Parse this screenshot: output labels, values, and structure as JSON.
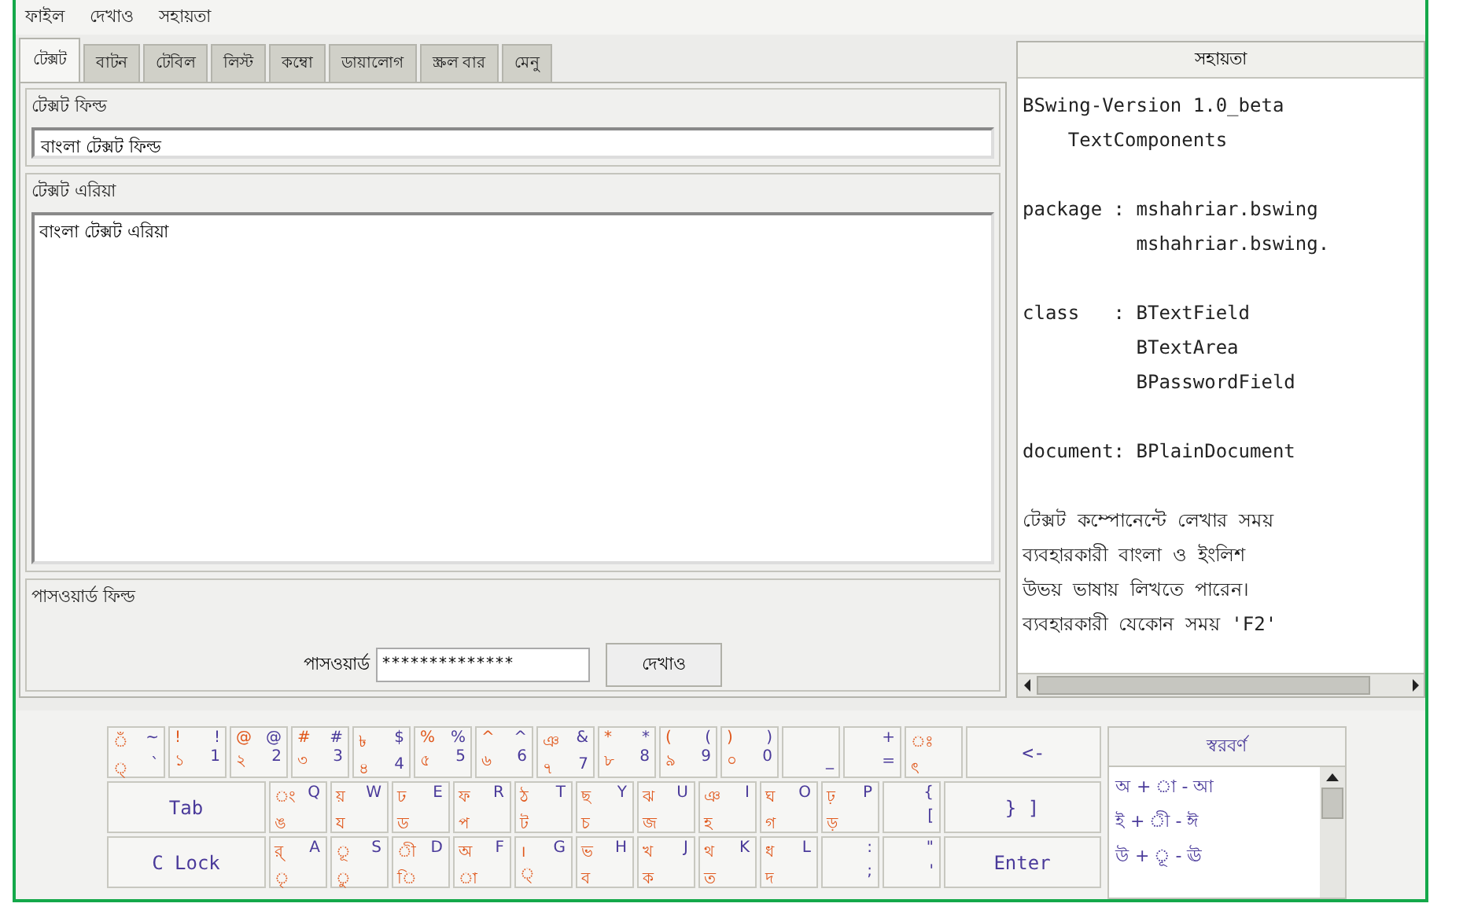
{
  "menu": [
    {
      "label": "ফাইল"
    },
    {
      "label": "দেখাও"
    },
    {
      "label": "সহায়তা"
    }
  ],
  "tabs": [
    {
      "label": "টেক্সট",
      "selected": true
    },
    {
      "label": "বাটন",
      "selected": false
    },
    {
      "label": "টেবিল",
      "selected": false
    },
    {
      "label": "লিস্ট",
      "selected": false
    },
    {
      "label": "কম্বো",
      "selected": false
    },
    {
      "label": "ডায়ালোগ",
      "selected": false
    },
    {
      "label": "স্ক্রল বার",
      "selected": false
    },
    {
      "label": "মেনু",
      "selected": false
    }
  ],
  "text_field_group": {
    "title": "টেক্সট ফিল্ড",
    "value": "বাংলা টেক্সট ফিল্ড"
  },
  "text_area_group": {
    "title": "টেক্সট এরিয়া",
    "value": "বাংলা টেক্সট এরিয়া"
  },
  "password_group": {
    "title": "পাসওয়ার্ড ফিল্ড",
    "label": "পাসওয়ার্ড",
    "value": "**************",
    "button": "দেখাও"
  },
  "help_panel": {
    "title": "সহায়তা",
    "paragraphs": [
      [
        "BSwing-Version 1.0_beta",
        "    TextComponents"
      ],
      [
        "package : mshahriar.bswing",
        "          mshahriar.bswing."
      ],
      [
        "class   : BTextField",
        "          BTextArea",
        "          BPasswordField"
      ],
      [
        "document: BPlainDocument"
      ],
      [
        "টেক্সট কম্পোনেন্টে লেখার সময়",
        "ব্যবহারকারী বাংলা ও ইংলিশ",
        "উভয় ভাষায় লিখতে পারেন।",
        "ব্যবহারকারী যেকোন সময় 'F2'"
      ]
    ]
  },
  "keyboard": {
    "number_row": [
      {
        "kind": "char",
        "bn_upper": "ঁ",
        "en_upper": "~",
        "bn_lower": "্",
        "en_lower": "`"
      },
      {
        "kind": "char",
        "bn_upper": "!",
        "en_upper": "!",
        "bn_lower": "১",
        "en_lower": "1"
      },
      {
        "kind": "char",
        "bn_upper": "@",
        "en_upper": "@",
        "bn_lower": "২",
        "en_lower": "2"
      },
      {
        "kind": "char",
        "bn_upper": "#",
        "en_upper": "#",
        "bn_lower": "৩",
        "en_lower": "3"
      },
      {
        "kind": "char",
        "bn_upper": "৳",
        "en_upper": "$",
        "bn_lower": "৪",
        "en_lower": "4"
      },
      {
        "kind": "char",
        "bn_upper": "%",
        "en_upper": "%",
        "bn_lower": "৫",
        "en_lower": "5"
      },
      {
        "kind": "char",
        "bn_upper": "^",
        "en_upper": "^",
        "bn_lower": "৬",
        "en_lower": "6"
      },
      {
        "kind": "char",
        "bn_upper": "ঞ",
        "en_upper": "&",
        "bn_lower": "৭",
        "en_lower": "7"
      },
      {
        "kind": "char",
        "bn_upper": "*",
        "en_upper": "*",
        "bn_lower": "৮",
        "en_lower": "8"
      },
      {
        "kind": "char",
        "bn_upper": "(",
        "en_upper": "(",
        "bn_lower": "৯",
        "en_lower": "9"
      },
      {
        "kind": "char",
        "bn_upper": ")",
        "en_upper": ")",
        "bn_lower": "০",
        "en_lower": "0"
      },
      {
        "kind": "char",
        "en_lower": "_"
      },
      {
        "kind": "char",
        "en_upper": "+",
        "en_lower": "="
      },
      {
        "kind": "char",
        "bn_upper": "ঃ",
        "bn_lower": "ৎ"
      },
      {
        "kind": "wide",
        "label": "<-"
      }
    ],
    "top_row": [
      {
        "kind": "wide",
        "label": "Tab"
      },
      {
        "kind": "char",
        "bn_upper": "ং",
        "en_upper": "Q",
        "bn_lower": "ঙ"
      },
      {
        "kind": "char",
        "bn_upper": "য়",
        "en_upper": "W",
        "bn_lower": "য"
      },
      {
        "kind": "char",
        "bn_upper": "ঢ",
        "en_upper": "E",
        "bn_lower": "ড"
      },
      {
        "kind": "char",
        "bn_upper": "ফ",
        "en_upper": "R",
        "bn_lower": "প"
      },
      {
        "kind": "char",
        "bn_upper": "ঠ",
        "en_upper": "T",
        "bn_lower": "ট"
      },
      {
        "kind": "char",
        "bn_upper": "ছ",
        "en_upper": "Y",
        "bn_lower": "চ"
      },
      {
        "kind": "char",
        "bn_upper": "ঝ",
        "en_upper": "U",
        "bn_lower": "জ"
      },
      {
        "kind": "char",
        "bn_upper": "ঞ",
        "en_upper": "I",
        "bn_lower": "হ"
      },
      {
        "kind": "char",
        "bn_upper": "ঘ",
        "en_upper": "O",
        "bn_lower": "গ"
      },
      {
        "kind": "char",
        "bn_upper": "ঢ়",
        "en_upper": "P",
        "bn_lower": "ড়"
      },
      {
        "kind": "char",
        "en_upper": "{",
        "en_lower": "["
      },
      {
        "kind": "wide",
        "label": "} ]"
      }
    ],
    "home_row": [
      {
        "kind": "wide",
        "label": "C Lock"
      },
      {
        "kind": "char",
        "bn_upper": "র্",
        "en_upper": "A",
        "bn_lower": "ৃ"
      },
      {
        "kind": "char",
        "bn_upper": "ূ",
        "en_upper": "S",
        "bn_lower": "ু"
      },
      {
        "kind": "char",
        "bn_upper": "ী",
        "en_upper": "D",
        "bn_lower": "ি"
      },
      {
        "kind": "char",
        "bn_upper": "অ",
        "en_upper": "F",
        "bn_lower": "া"
      },
      {
        "kind": "char",
        "bn_upper": "।",
        "en_upper": "G",
        "bn_lower": "্"
      },
      {
        "kind": "char",
        "bn_upper": "ভ",
        "en_upper": "H",
        "bn_lower": "ব"
      },
      {
        "kind": "char",
        "bn_upper": "খ",
        "en_upper": "J",
        "bn_lower": "ক"
      },
      {
        "kind": "char",
        "bn_upper": "থ",
        "en_upper": "K",
        "bn_lower": "ত"
      },
      {
        "kind": "char",
        "bn_upper": "ধ",
        "en_upper": "L",
        "bn_lower": "দ"
      },
      {
        "kind": "char",
        "en_upper": ":",
        "en_lower": ";"
      },
      {
        "kind": "char",
        "en_upper": "\"",
        "en_lower": "'"
      },
      {
        "kind": "wide",
        "label": "Enter"
      }
    ]
  },
  "vowel_list": {
    "title": "স্বরবর্ণ",
    "items": [
      "অ + া - আ",
      "ই + ী - ঈ",
      "উ + ূ - ঊ"
    ]
  }
}
